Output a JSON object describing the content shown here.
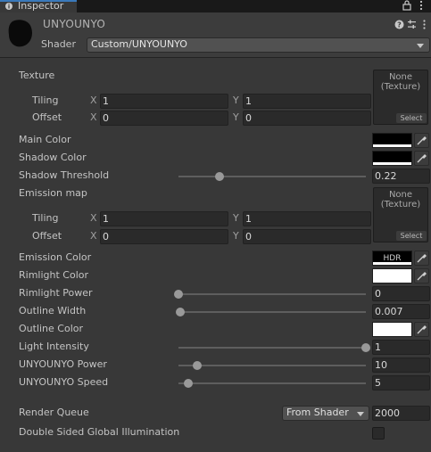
{
  "window": {
    "tab_label": "Inspector",
    "tab_icon": "info-icon"
  },
  "material": {
    "name": "UNYOUNYO",
    "shader_label": "Shader",
    "shader_value": "Custom/UNYOUNYO"
  },
  "properties": {
    "texture": {
      "label": "Texture",
      "tiling_label": "Tiling",
      "offset_label": "Offset",
      "x": "X",
      "y": "Y",
      "tiling_x": "1",
      "tiling_y": "1",
      "offset_x": "0",
      "offset_y": "0",
      "slot_text_1": "None",
      "slot_text_2": "(Texture)",
      "select_label": "Select"
    },
    "main_color": {
      "label": "Main Color",
      "color": "#000000"
    },
    "shadow_color": {
      "label": "Shadow Color",
      "color": "#000000"
    },
    "shadow_threshold": {
      "label": "Shadow Threshold",
      "value": "0.22",
      "fraction": 0.22
    },
    "emission_map": {
      "label": "Emission map",
      "tiling_label": "Tiling",
      "offset_label": "Offset",
      "x": "X",
      "y": "Y",
      "tiling_x": "1",
      "tiling_y": "1",
      "offset_x": "0",
      "offset_y": "0",
      "slot_text_1": "None",
      "slot_text_2": "(Texture)",
      "select_label": "Select"
    },
    "emission_color": {
      "label": "Emission Color",
      "badge": "HDR",
      "color": "#000000"
    },
    "rimlight_color": {
      "label": "Rimlight Color",
      "color": "#ffffff"
    },
    "rimlight_power": {
      "label": "Rimlight Power",
      "value": "0",
      "fraction": 0.0
    },
    "outline_width": {
      "label": "Outline Width",
      "value": "0.007",
      "fraction": 0.01
    },
    "outline_color": {
      "label": "Outline Color",
      "color": "#ffffff"
    },
    "light_intensity": {
      "label": "Light Intensity",
      "value": "1",
      "fraction": 1.0
    },
    "unyounyo_power": {
      "label": "UNYOUNYO Power",
      "value": "10",
      "fraction": 0.1
    },
    "unyounyo_speed": {
      "label": "UNYOUNYO Speed",
      "value": "5",
      "fraction": 0.05
    }
  },
  "render_queue": {
    "label": "Render Queue",
    "mode": "From Shader",
    "value": "2000"
  },
  "double_sided_gi": {
    "label": "Double Sided Global Illumination",
    "checked": false
  },
  "colors": {
    "accent": "#3a79bb",
    "panel": "#383838"
  }
}
